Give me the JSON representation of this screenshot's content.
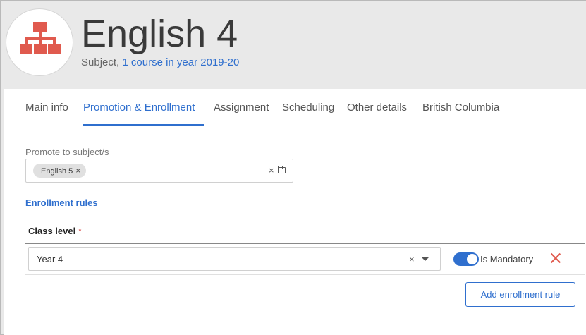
{
  "header": {
    "title": "English 4",
    "subtitle_prefix": "Subject, ",
    "subtitle_link": "1 course in year 2019-20",
    "avatar_icon": "hierarchy-icon",
    "avatar_color": "#e05a4e"
  },
  "tabs": [
    {
      "label": "Main info"
    },
    {
      "label": "Promotion & Enrollment"
    },
    {
      "label": "Assignment"
    },
    {
      "label": "Scheduling"
    },
    {
      "label": "Other details"
    },
    {
      "label": "British Columbia"
    }
  ],
  "active_tab": "Promotion & Enrollment",
  "promote": {
    "label": "Promote to subject/s",
    "chips": [
      {
        "label": "English 5"
      }
    ],
    "chip_remove": "×",
    "clear_icon": "×"
  },
  "enrollment": {
    "section_title": "Enrollment rules",
    "column_header": "Class level",
    "required_mark": "*",
    "rows": [
      {
        "class_level": "Year 4",
        "clear_icon": "×",
        "mandatory_label": "Is Mandatory",
        "mandatory": true
      }
    ],
    "add_button": "Add enrollment rule"
  },
  "colors": {
    "accent": "#2f6fce",
    "danger": "#e05a4e"
  }
}
